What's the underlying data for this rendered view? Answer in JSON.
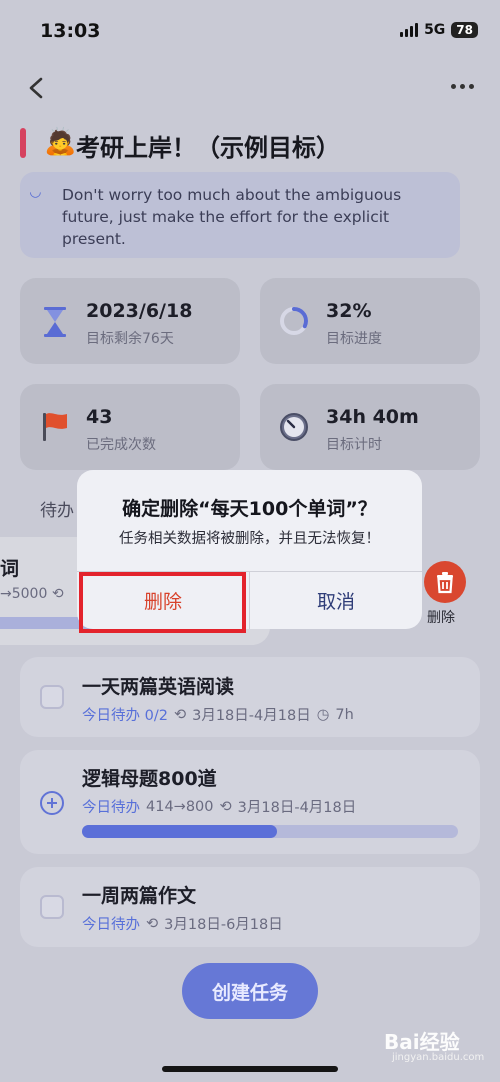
{
  "status_bar": {
    "time": "13:03",
    "network": "5G",
    "battery": "78"
  },
  "page": {
    "title_emoji": "🙇",
    "title": "考研上岸！（示例目标）",
    "quote_icon": "◡",
    "quote": "Don't worry too much about the ambiguous future, just make the effort for the explicit present."
  },
  "stats": [
    {
      "icon": "hourglass-icon",
      "value": "2023/6/18",
      "label": "目标剩余76天"
    },
    {
      "icon": "progress-ring-icon",
      "value": "32%",
      "label": "目标进度",
      "progress": 0.32
    },
    {
      "icon": "flag-icon",
      "value": "43",
      "label": "已完成次数"
    },
    {
      "icon": "clock-icon",
      "value": "34h 40m",
      "label": "目标计时"
    }
  ],
  "list": {
    "section_label": "待办",
    "swiped_task": {
      "title": "词",
      "sub": "→5000"
    },
    "swipe_delete_label": "删除",
    "tasks": [
      {
        "title": "一天两篇英语阅读",
        "today": "今日待办 0/2",
        "dates": "3月18日-4月18日",
        "duration": "7h"
      },
      {
        "title": "逻辑母题800道",
        "today": "今日待办",
        "count": "414→800",
        "dates": "3月18日-4月18日",
        "progress": 0.5176
      },
      {
        "title": "一周两篇作文",
        "today": "今日待办",
        "dates": "3月18日-6月18日"
      }
    ],
    "create_button": "创建任务"
  },
  "dialog": {
    "title": "确定删除“每天100个单词”？",
    "message": "任务相关数据将被删除，并且无法恢复！",
    "delete_label": "删除",
    "cancel_label": "取消"
  },
  "watermark": {
    "brand": "Bai经验",
    "url": "jingyan.baidu.com"
  },
  "colors": {
    "accent": "#5b6fd8",
    "danger": "#d8422b",
    "title_bar": "#d6425f"
  }
}
